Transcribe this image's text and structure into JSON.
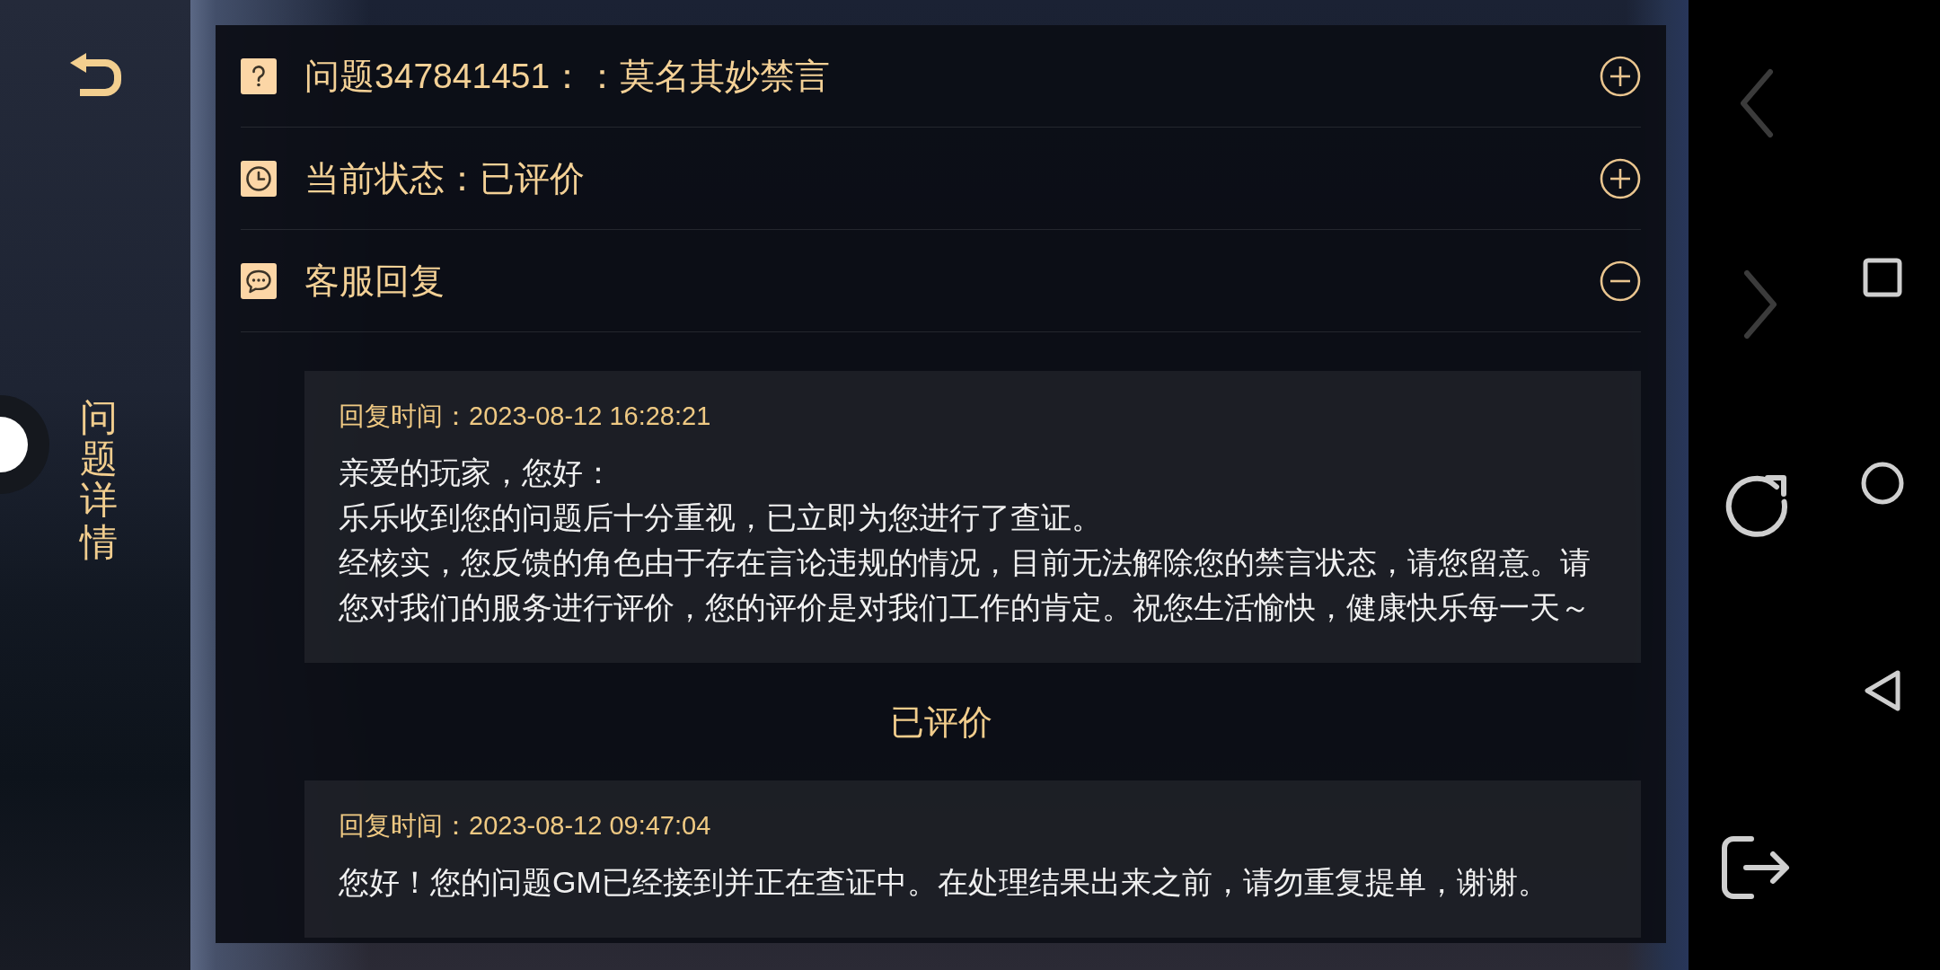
{
  "sidebar": {
    "title": "问题详情"
  },
  "sections": [
    {
      "kind": "question",
      "title": "问题347841451：：莫名其妙禁言",
      "expanded": false
    },
    {
      "kind": "status",
      "title": "当前状态：已评价",
      "expanded": false
    },
    {
      "kind": "replies",
      "title": "客服回复",
      "expanded": true
    }
  ],
  "replies": [
    {
      "kind": "message",
      "time": "回复时间：2023-08-12 16:28:21",
      "paragraphs": [
        "亲爱的玩家，您好：",
        "乐乐收到您的问题后十分重视，已立即为您进行了查证。",
        "经核实，您反馈的角色由于存在言论违规的情况，目前无法解除您的禁言状态，请您留意。请您对我们的服务进行评价，您的评价是对我们工作的肯定。祝您生活愉快，健康快乐每一天～"
      ]
    },
    {
      "kind": "status",
      "text": "已评价"
    },
    {
      "kind": "message",
      "time": "回复时间：2023-08-12 09:47:04",
      "paragraphs": [
        "您好！您的问题GM已经接到并正在查证中。在处理结果出来之前，请勿重复提单，谢谢。"
      ]
    }
  ],
  "web_controls": [
    {
      "kind": "back",
      "disabled": true
    },
    {
      "kind": "forward",
      "disabled": true
    },
    {
      "kind": "refresh",
      "disabled": false
    },
    {
      "kind": "exit",
      "disabled": false
    }
  ]
}
